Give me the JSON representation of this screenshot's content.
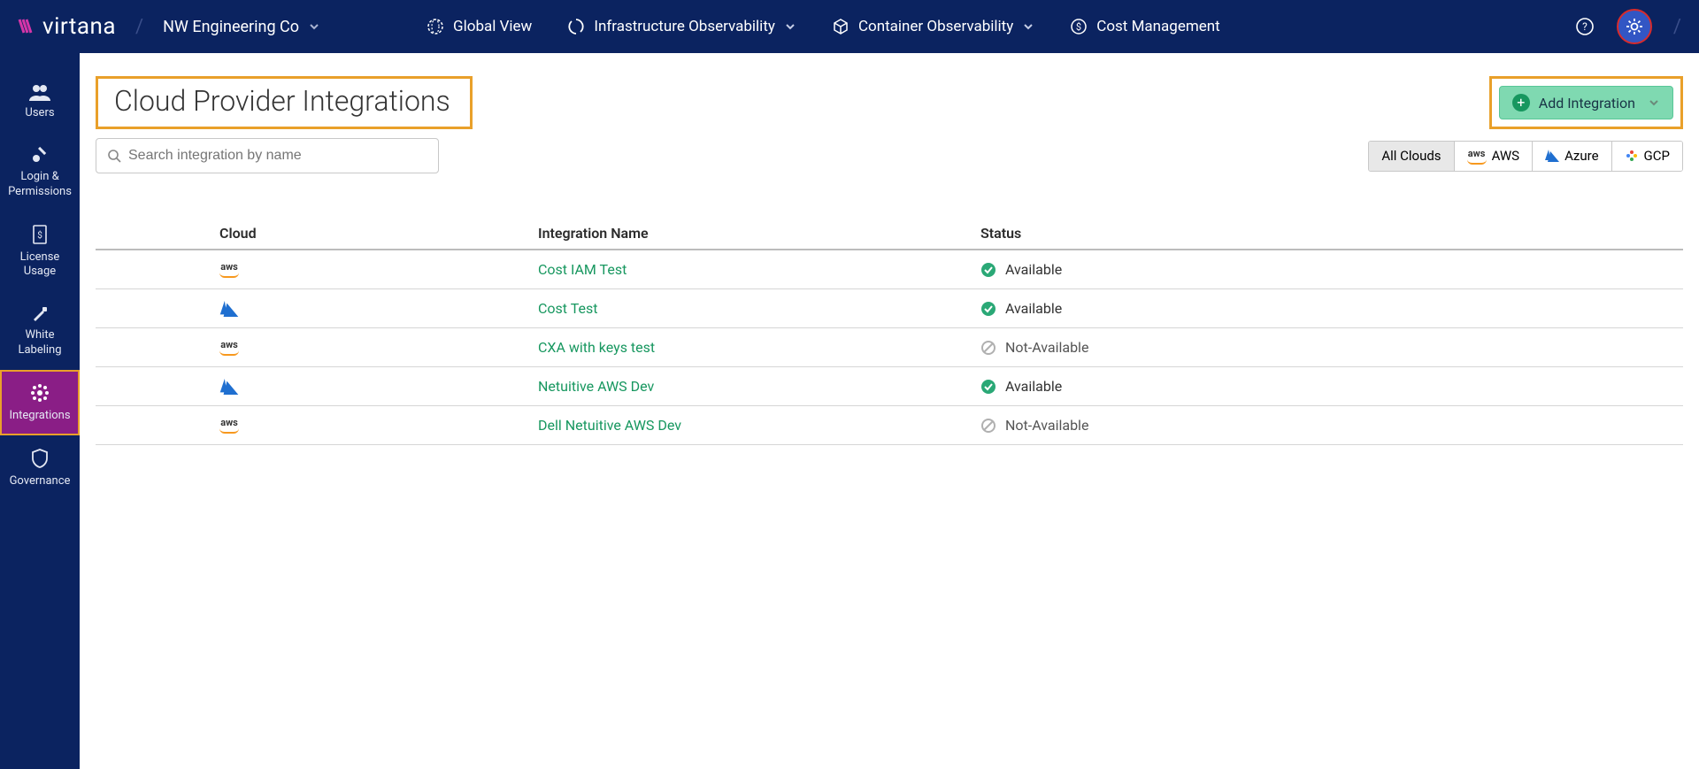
{
  "brand": "virtana",
  "org": "NW Engineering Co",
  "nav": [
    {
      "label": "Global View",
      "icon": "globe-icon",
      "dropdown": false
    },
    {
      "label": "Infrastructure Observability",
      "icon": "swirl-icon",
      "dropdown": true
    },
    {
      "label": "Container Observability",
      "icon": "cube-icon",
      "dropdown": true
    },
    {
      "label": "Cost Management",
      "icon": "dollar-circle-icon",
      "dropdown": false
    }
  ],
  "sidebar": [
    {
      "label": "Users",
      "icon": "users-icon"
    },
    {
      "label": "Login & Permissions",
      "icon": "key-icon"
    },
    {
      "label": "License Usage",
      "icon": "license-icon"
    },
    {
      "label": "White Labeling",
      "icon": "brush-icon"
    },
    {
      "label": "Integrations",
      "icon": "integrations-icon"
    },
    {
      "label": "Governance",
      "icon": "shield-icon"
    }
  ],
  "active_sidebar_index": 4,
  "page": {
    "title": "Cloud Provider Integrations",
    "add_button": "Add Integration",
    "search_placeholder": "Search integration by name"
  },
  "filters": {
    "items": [
      "All Clouds",
      "AWS",
      "Azure",
      "GCP"
    ],
    "active_index": 0
  },
  "table": {
    "columns": [
      "Cloud",
      "Integration Name",
      "Status"
    ],
    "rows": [
      {
        "cloud": "aws",
        "name": "Cost IAM Test",
        "status": "Available"
      },
      {
        "cloud": "azure",
        "name": "Cost Test",
        "status": "Available"
      },
      {
        "cloud": "aws",
        "name": "CXA with keys test",
        "status": "Not-Available"
      },
      {
        "cloud": "azure",
        "name": "Netuitive AWS Dev",
        "status": "Available"
      },
      {
        "cloud": "aws",
        "name": "Dell Netuitive AWS Dev",
        "status": "Not-Available"
      }
    ]
  }
}
